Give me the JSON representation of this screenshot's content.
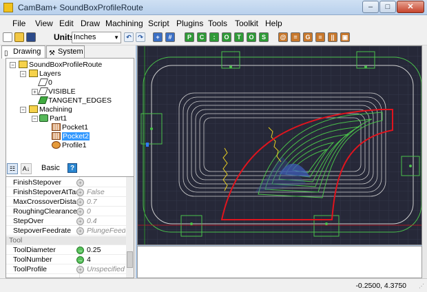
{
  "window": {
    "title": "CamBam+  SoundBoxProfileRoute",
    "min_glyph": "–",
    "max_glyph": "□",
    "close_glyph": "✕"
  },
  "menu": [
    "File",
    "View",
    "Edit",
    "Draw",
    "Machining",
    "Script",
    "Plugins",
    "Tools",
    "Toolkit",
    "Help"
  ],
  "toolbar": {
    "units_label": "Units",
    "units_value": "Inches"
  },
  "tabs": {
    "drawing": "Drawing",
    "system": "System"
  },
  "tree": {
    "root": "SoundBoxProfileRoute",
    "layers": "Layers",
    "layer_0": "0",
    "layer_visible": "VISIBLE",
    "layer_tangent": "TANGENT_EDGES",
    "machining": "Machining",
    "part": "Part1",
    "pocket1": "Pocket1",
    "pocket2": "Pocket2",
    "profile1": "Profile1"
  },
  "properties": {
    "mode_label": "Basic",
    "help_glyph": "?",
    "rows": [
      {
        "name": "FinishStepover",
        "value": "",
        "set": false
      },
      {
        "name": "FinishStepoverAtTarget",
        "value": "False",
        "set": false
      },
      {
        "name": "MaxCrossoverDistance",
        "value": "0.7",
        "set": false
      },
      {
        "name": "RoughingClearance",
        "value": "0",
        "set": false
      },
      {
        "name": "StepOver",
        "value": "0.4",
        "set": false
      },
      {
        "name": "StepoverFeedrate",
        "value": "PlungeFeedrate",
        "set": false
      },
      {
        "name": "Tool",
        "value": "",
        "category": true
      },
      {
        "name": "ToolDiameter",
        "value": "0.25",
        "set": true
      },
      {
        "name": "ToolNumber",
        "value": "4",
        "set": true
      },
      {
        "name": "ToolProfile",
        "value": "Unspecified",
        "set": false
      }
    ]
  },
  "status": {
    "coords": "-0.2500, 4.3750"
  },
  "colors": {
    "canvas_bg": "#262838",
    "grid": "#3a3d52",
    "outline": "#d8d8d8",
    "toolpath": "#4bc24b",
    "profile": "#e0141e",
    "lead": "#e8d020",
    "fill": "#3f5fbf"
  }
}
